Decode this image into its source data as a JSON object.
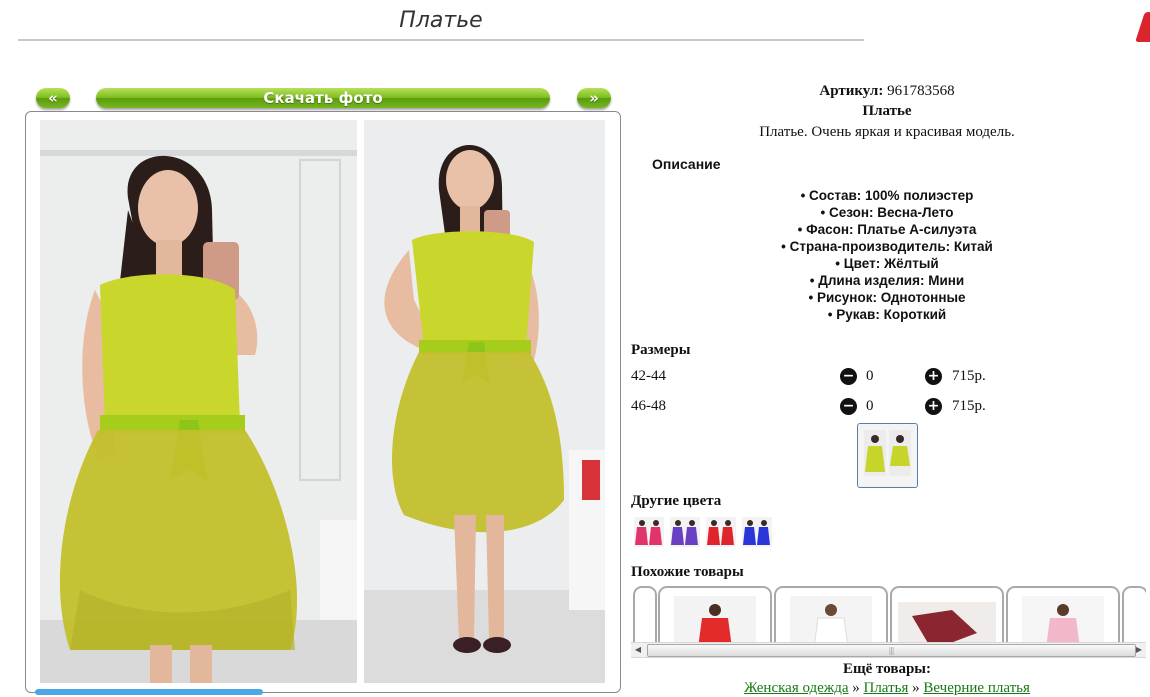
{
  "page": {
    "title": "Платье"
  },
  "gallery": {
    "prev_label": "«",
    "download_label": "Скачать фото",
    "next_label": "»"
  },
  "product": {
    "article_label": "Артикул:",
    "article_value": "961783568",
    "name": "Платье",
    "short_desc": "Платье. Очень яркая и красивая модель."
  },
  "description": {
    "heading": "Описание",
    "specs": [
      "Состав: 100% полиэстер",
      "Сезон: Весна-Лето",
      "Фасон: Платье А-силуэта",
      "Страна-производитель: Китай",
      "Цвет: Жёлтый",
      "Длина изделия: Мини",
      "Рисунок: Однотонные",
      "Рукав: Короткий"
    ]
  },
  "sizes": {
    "heading": "Размеры",
    "rows": [
      {
        "label": "42-44",
        "qty": "0",
        "price": "715р."
      },
      {
        "label": "46-48",
        "qty": "0",
        "price": "715р."
      }
    ]
  },
  "other_colors": {
    "heading": "Другие цвета",
    "colors": [
      "#e0346a",
      "#6a3fc4",
      "#e0242c",
      "#2a36d8"
    ]
  },
  "similar": {
    "heading": "Похожие товары"
  },
  "more": {
    "heading": "Ещё товары:",
    "crumbs": [
      "Женская одежда",
      "Платья",
      "Вечерние платья"
    ],
    "separator": "»"
  },
  "colors": {
    "accent_green": "#7fbe1f",
    "dress": "#c7d52a",
    "link_green": "#177a17"
  }
}
